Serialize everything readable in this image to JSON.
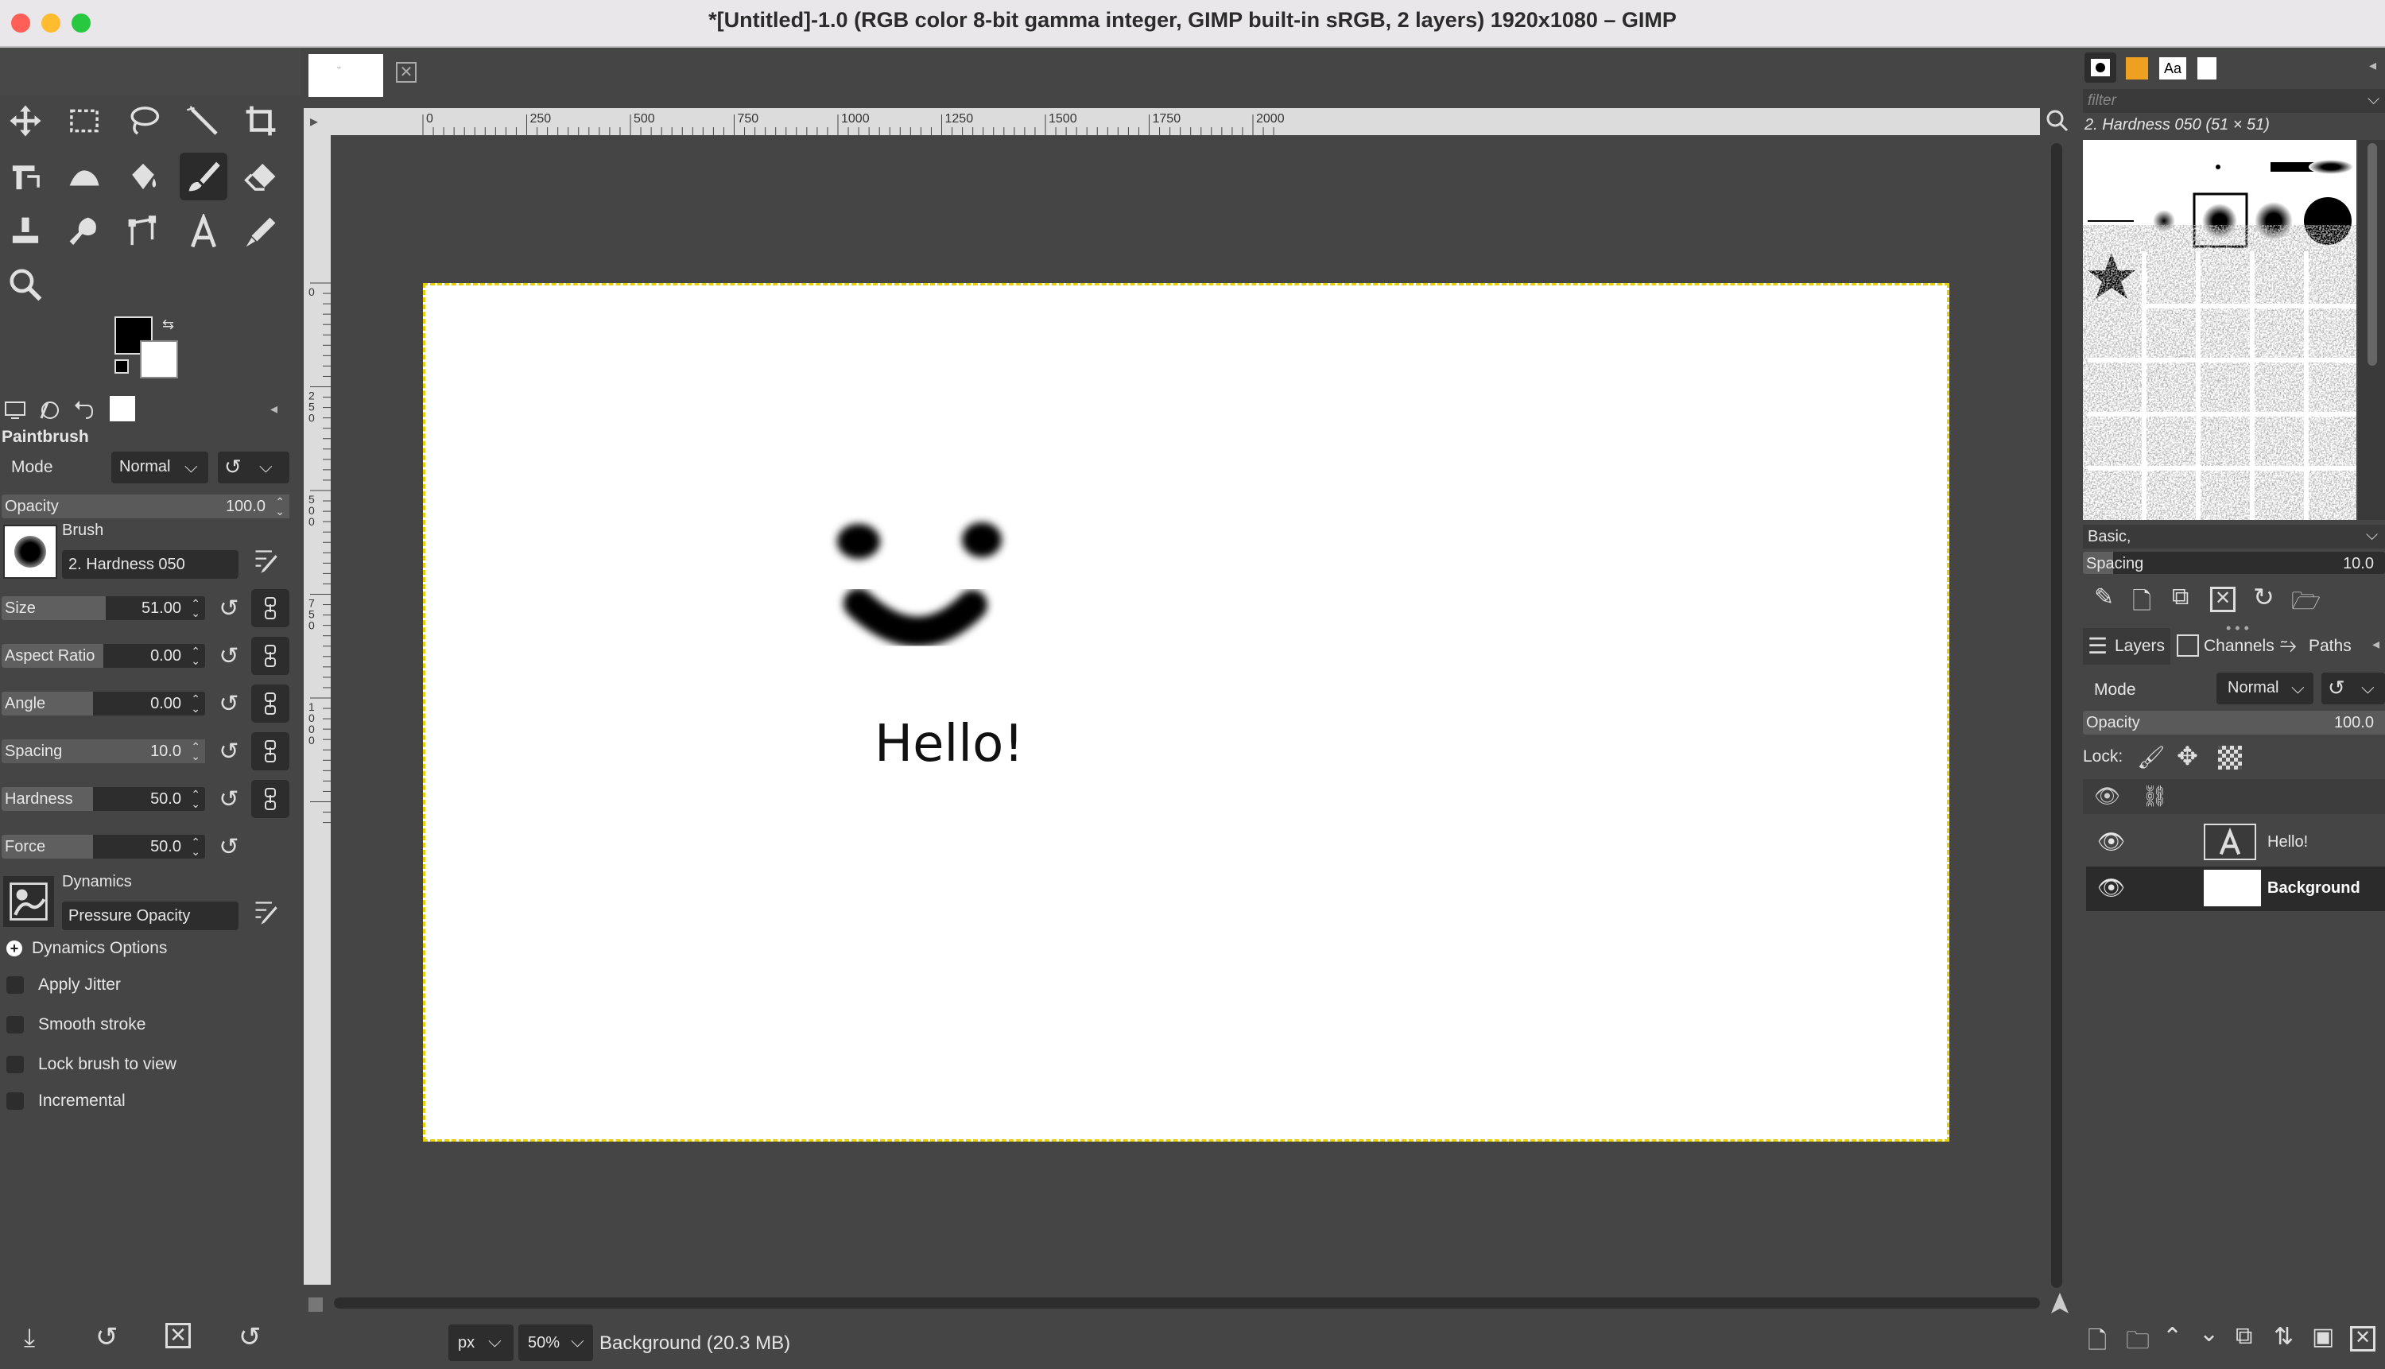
{
  "window": {
    "title": "*[Untitled]-1.0 (RGB color 8-bit gamma integer, GIMP built-in sRGB, 2 layers) 1920x1080 – GIMP",
    "traffic_colors": [
      "#ff5f57",
      "#febc2e",
      "#28c840"
    ]
  },
  "toolbox": {
    "tools": [
      "move-icon",
      "rect-select-icon",
      "lasso-icon",
      "fuzzy-select-icon",
      "crop-icon",
      "unified-transform-icon",
      "warp-transform-icon",
      "bucket-fill-icon",
      "paintbrush-icon",
      "eraser-icon",
      "clone-icon",
      "smudge-icon",
      "paths-icon",
      "text-icon",
      "color-picker-icon",
      "zoom-icon"
    ],
    "fg_color": "#000000",
    "bg_color": "#ffffff"
  },
  "tool_options": {
    "title": "Paintbrush",
    "mode_label": "Mode",
    "mode_value": "Normal",
    "opacity_label": "Opacity",
    "opacity_value": "100.0",
    "brush_label": "Brush",
    "brush_name": "2. Hardness 050",
    "sliders": [
      {
        "name": "Size",
        "value": "51.00",
        "fraction": 0.51
      },
      {
        "name": "Aspect Ratio",
        "value": "0.00",
        "fraction": 0.5
      },
      {
        "name": "Angle",
        "value": "0.00",
        "fraction": 0.5
      },
      {
        "name": "Spacing",
        "value": "10.0",
        "fraction": 0.1
      },
      {
        "name": "Hardness",
        "value": "50.0",
        "fraction": 0.5
      },
      {
        "name": "Force",
        "value": "50.0",
        "fraction": 0.5
      }
    ],
    "dynamics_label": "Dynamics",
    "dynamics_value": "Pressure Opacity",
    "dynamics_options": "Dynamics Options",
    "checks": [
      "Apply Jitter",
      "Smooth stroke",
      "Lock brush to view",
      "Incremental"
    ]
  },
  "ruler": {
    "h_ticks": [
      "0",
      "250",
      "500",
      "750",
      "1000",
      "1250",
      "1500",
      "1750",
      "2000"
    ],
    "v_ticks": [
      "0",
      "250",
      "500",
      "750",
      "1000"
    ]
  },
  "canvas": {
    "text": "Hello!"
  },
  "statusbar": {
    "unit": "px",
    "zoom": "50%",
    "message": "Background (20.3 MB)"
  },
  "brushes_panel": {
    "filter_placeholder": "filter",
    "selected_brush": "2. Hardness 050 (51 × 51)",
    "tag": "Basic,",
    "spacing_label": "Spacing",
    "spacing_value": "10.0"
  },
  "layers_panel": {
    "tabs": [
      "Layers",
      "Channels",
      "Paths"
    ],
    "mode_label": "Mode",
    "mode_value": "Normal",
    "opacity_label": "Opacity",
    "opacity_value": "100.0",
    "lock_label": "Lock:",
    "layers": [
      {
        "name": "Hello!",
        "bold": false
      },
      {
        "name": "Background",
        "bold": true
      }
    ]
  }
}
